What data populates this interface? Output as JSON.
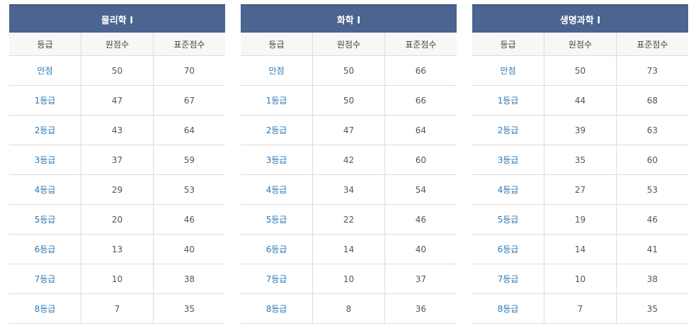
{
  "columns": [
    "등급",
    "원점수",
    "표준점수"
  ],
  "tables": [
    {
      "title": "물리학 I",
      "rows": [
        {
          "grade": "만점",
          "raw": "50",
          "std": "70"
        },
        {
          "grade": "1등급",
          "raw": "47",
          "std": "67"
        },
        {
          "grade": "2등급",
          "raw": "43",
          "std": "64"
        },
        {
          "grade": "3등급",
          "raw": "37",
          "std": "59"
        },
        {
          "grade": "4등급",
          "raw": "29",
          "std": "53"
        },
        {
          "grade": "5등급",
          "raw": "20",
          "std": "46"
        },
        {
          "grade": "6등급",
          "raw": "13",
          "std": "40"
        },
        {
          "grade": "7등급",
          "raw": "10",
          "std": "38"
        },
        {
          "grade": "8등급",
          "raw": "7",
          "std": "35"
        }
      ]
    },
    {
      "title": "화학 I",
      "rows": [
        {
          "grade": "만점",
          "raw": "50",
          "std": "66"
        },
        {
          "grade": "1등급",
          "raw": "50",
          "std": "66"
        },
        {
          "grade": "2등급",
          "raw": "47",
          "std": "64"
        },
        {
          "grade": "3등급",
          "raw": "42",
          "std": "60"
        },
        {
          "grade": "4등급",
          "raw": "34",
          "std": "54"
        },
        {
          "grade": "5등급",
          "raw": "22",
          "std": "46"
        },
        {
          "grade": "6등급",
          "raw": "14",
          "std": "40"
        },
        {
          "grade": "7등급",
          "raw": "10",
          "std": "37"
        },
        {
          "grade": "8등급",
          "raw": "8",
          "std": "36"
        }
      ]
    },
    {
      "title": "생명과학 I",
      "rows": [
        {
          "grade": "만점",
          "raw": "50",
          "std": "73"
        },
        {
          "grade": "1등급",
          "raw": "44",
          "std": "68"
        },
        {
          "grade": "2등급",
          "raw": "39",
          "std": "63"
        },
        {
          "grade": "3등급",
          "raw": "35",
          "std": "60"
        },
        {
          "grade": "4등급",
          "raw": "27",
          "std": "53"
        },
        {
          "grade": "5등급",
          "raw": "19",
          "std": "46"
        },
        {
          "grade": "6등급",
          "raw": "14",
          "std": "41"
        },
        {
          "grade": "7등급",
          "raw": "10",
          "std": "38"
        },
        {
          "grade": "8등급",
          "raw": "7",
          "std": "35"
        }
      ]
    }
  ]
}
